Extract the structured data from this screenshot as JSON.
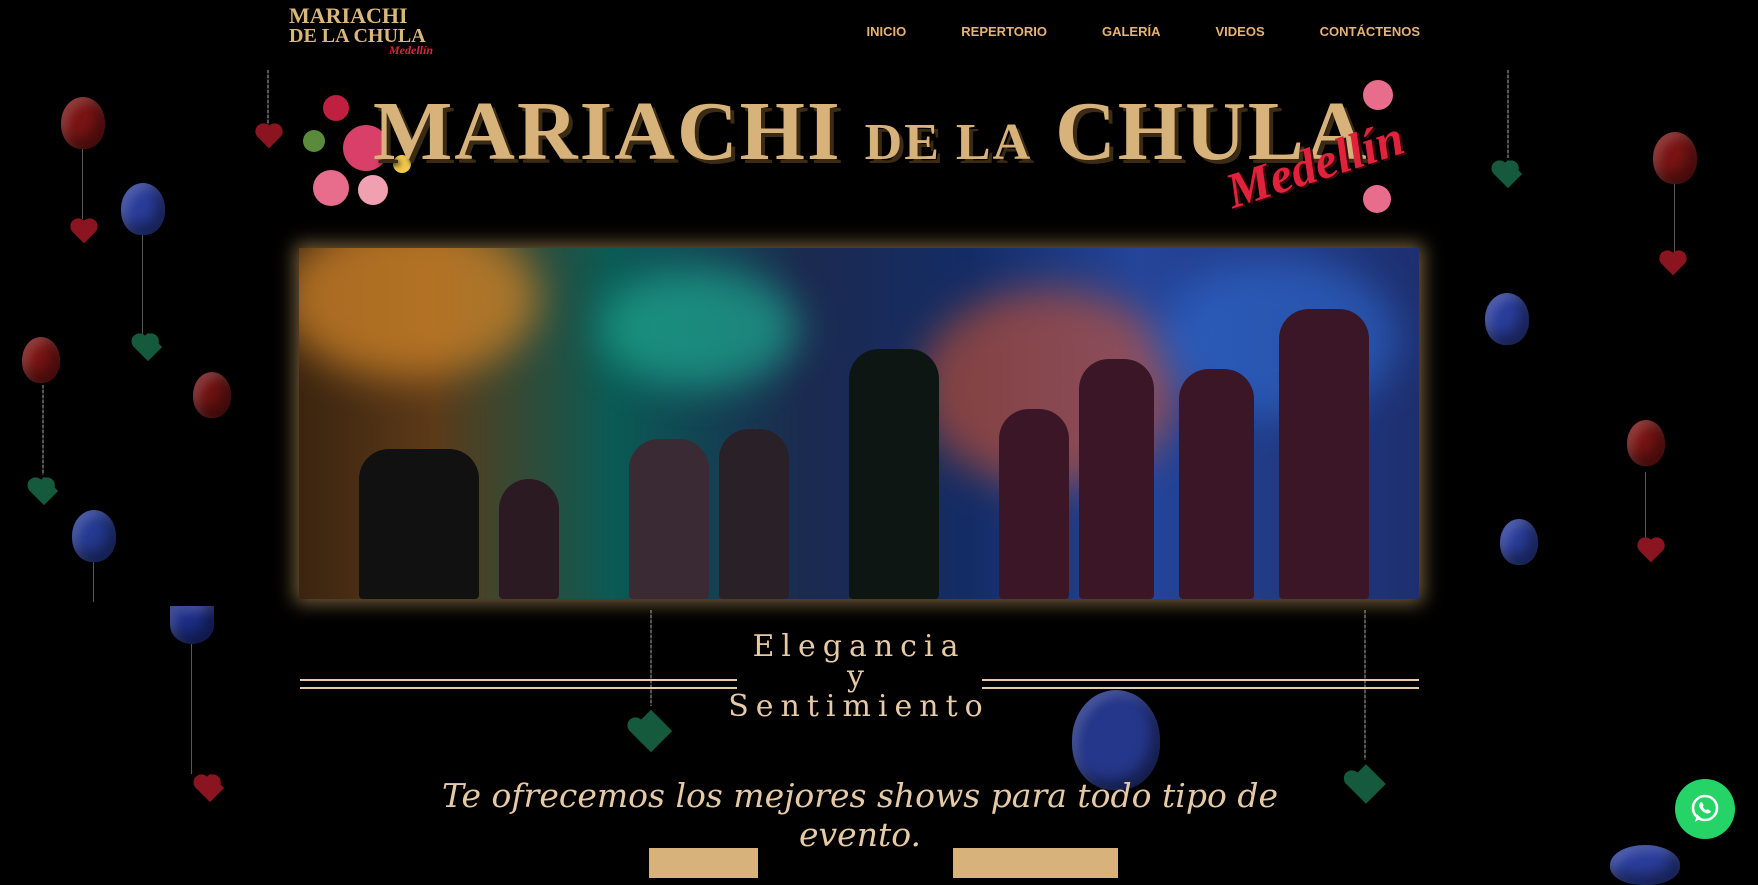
{
  "header": {
    "logo_line1": "MARIACHI",
    "logo_line2": "DE LA CHULA",
    "logo_line3": "Medellín"
  },
  "nav": {
    "items": [
      {
        "label": "INICIO"
      },
      {
        "label": "REPERTORIO"
      },
      {
        "label": "GALERÍA"
      },
      {
        "label": "VIDEOS"
      },
      {
        "label": "CONTÁCTENOS"
      }
    ]
  },
  "banner": {
    "title_main": "MARIACHI",
    "title_mid": "DE LA",
    "title_end": "CHULA",
    "subtitle": "Medellín"
  },
  "tagline": {
    "line1": "Elegancia",
    "line2": "y",
    "line3": "Sentimiento"
  },
  "offer": "Te ofrecemos los mejores shows para todo tipo de evento.",
  "buttons": {
    "left": "",
    "right": ""
  },
  "colors": {
    "gold": "#d7b27a",
    "nav": "#e8b273",
    "red": "#e0233a",
    "whatsapp": "#25d366"
  }
}
